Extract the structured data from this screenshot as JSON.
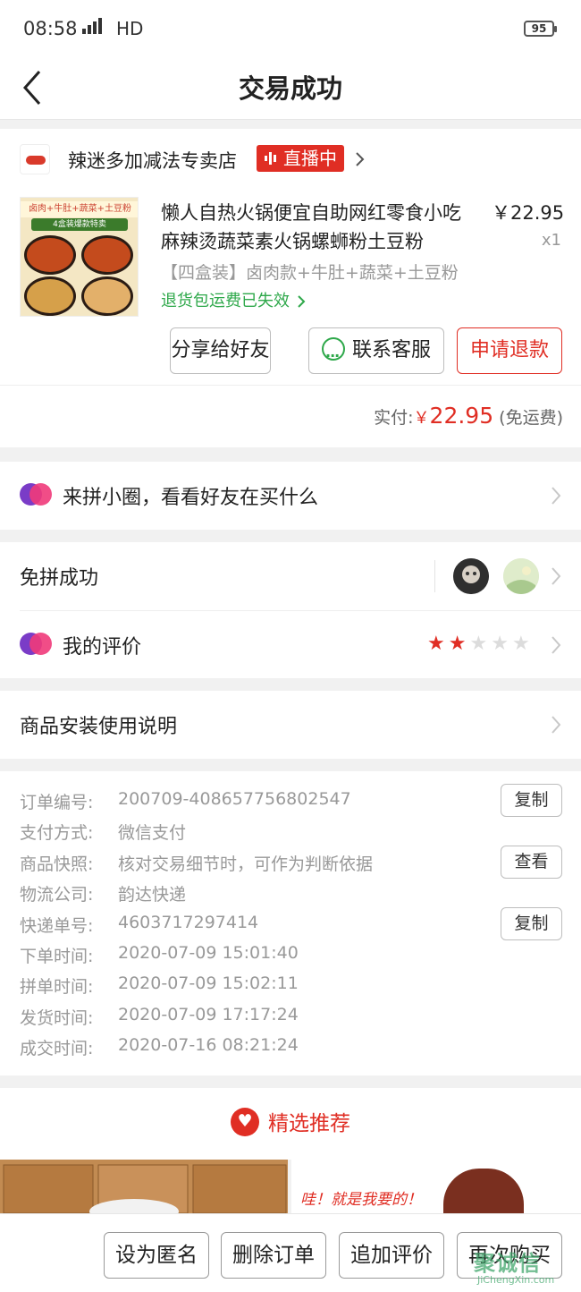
{
  "status_bar": {
    "time": "08:58",
    "network": "4G",
    "hd": "HD",
    "battery": "95"
  },
  "nav": {
    "title": "交易成功"
  },
  "shop": {
    "name": "辣迷多加减法专卖店",
    "live_label": "直播中"
  },
  "product": {
    "image_banner": "卤肉+牛肚+蔬菜+土豆粉",
    "image_banner2": "4盒装爆款特卖",
    "title": "懒人自热火锅便宜自助网红零食小吃麻辣烫蔬菜素火锅螺蛳粉土豆粉",
    "price": "￥22.95",
    "qty": "x1",
    "sku": "【四盒装】卤肉款+牛肚+蔬菜+土豆粉",
    "return_note": "退货包运费已失效"
  },
  "actions": {
    "share": "分享给好友",
    "contact": "联系客服",
    "refund": "申请退款"
  },
  "payment": {
    "label": "实付:",
    "currency": "￥",
    "amount": "22.95",
    "note": "(免运费)"
  },
  "circle": {
    "label": "来拼小圈，看看好友在买什么"
  },
  "group": {
    "label": "免拼成功"
  },
  "review": {
    "label": "我的评价",
    "rating": 2,
    "max": 5
  },
  "manual": {
    "label": "商品安装使用说明"
  },
  "order_info": [
    {
      "label": "订单编号:",
      "value": "200709-408657756802547",
      "button": "复制"
    },
    {
      "label": "支付方式:",
      "value": "微信支付"
    },
    {
      "label": "商品快照:",
      "value": "核对交易细节时，可作为判断依据",
      "button": "查看"
    },
    {
      "label": "物流公司:",
      "value": "韵达快递"
    },
    {
      "label": "快递单号:",
      "value": "4603717297414",
      "button": "复制"
    },
    {
      "label": "下单时间:",
      "value": "2020-07-09 15:01:40"
    },
    {
      "label": "拼单时间:",
      "value": "2020-07-09 15:02:11"
    },
    {
      "label": "发货时间:",
      "value": "2020-07-09 17:17:24"
    },
    {
      "label": "成交时间:",
      "value": "2020-07-16 08:21:24"
    }
  ],
  "recommend": {
    "title": "精选推荐",
    "slogan": "哇！就是我要的！"
  },
  "bottom": {
    "anonymous": "设为匿名",
    "delete": "删除订单",
    "add_review": "追加评价",
    "rebuy": "再次购买"
  },
  "watermark": {
    "main": "聚诚信",
    "sub": "JiChengXin.com"
  },
  "colors": {
    "accent": "#e02e24",
    "green": "#2ea84a",
    "muted": "#999999"
  }
}
